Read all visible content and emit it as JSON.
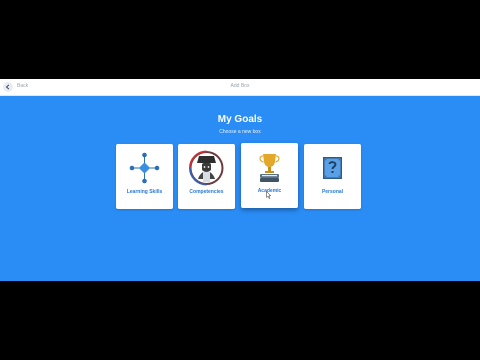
{
  "header": {
    "back_label": "Back",
    "title": "Add Box"
  },
  "main": {
    "heading": "My Goals",
    "subheading": "Choose a new box",
    "cards": [
      {
        "label": "Learning Skills",
        "icon": "network-icon"
      },
      {
        "label": "Competencies",
        "icon": "emblem-icon"
      },
      {
        "label": "Academic",
        "icon": "trophy-icon"
      },
      {
        "label": "Personal",
        "icon": "question-block-icon"
      }
    ]
  },
  "colors": {
    "background": "#2a8cf5",
    "card": "#ffffff",
    "label": "#2a7ad4"
  }
}
